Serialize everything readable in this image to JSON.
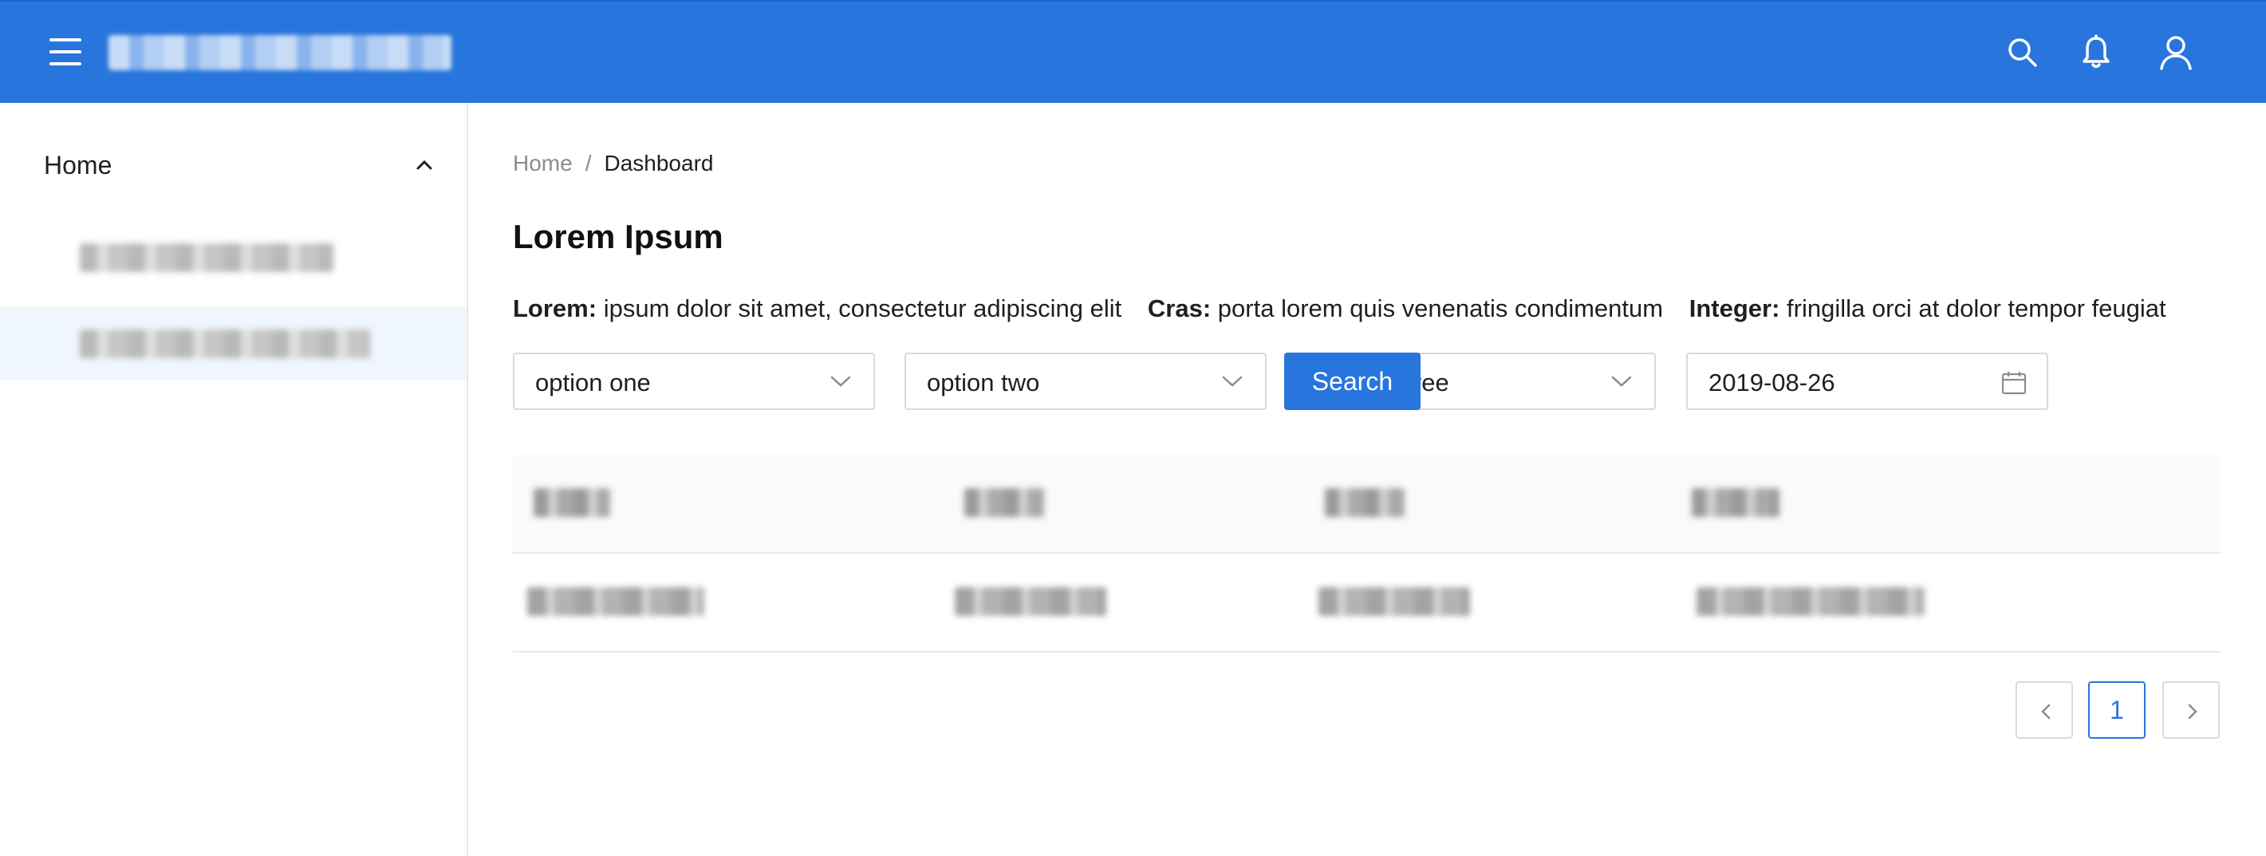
{
  "header": {
    "icons": [
      "menu-icon",
      "search-icon",
      "bell-icon",
      "user-icon"
    ],
    "accent_color": "#2775dd"
  },
  "sidebar": {
    "home_label": "Home"
  },
  "main": {
    "breadcrumb": {
      "home": "Home",
      "separator": "/",
      "current": "Dashboard"
    },
    "title": "Lorem Ipsum",
    "info": [
      {
        "key": "Lorem:",
        "value": "ipsum dolor sit amet, consectetur adipiscing elit"
      },
      {
        "key": "Cras:",
        "value": "porta lorem quis venenatis condimentum"
      },
      {
        "key": "Integer:",
        "value": "fringilla orci at dolor tempor feugiat"
      }
    ],
    "filters": {
      "select_one": "option one",
      "select_two": "option two",
      "select_three": "option three",
      "date": "2019-08-26",
      "search_label": "Search"
    },
    "pagination": {
      "current_page": "1"
    }
  }
}
